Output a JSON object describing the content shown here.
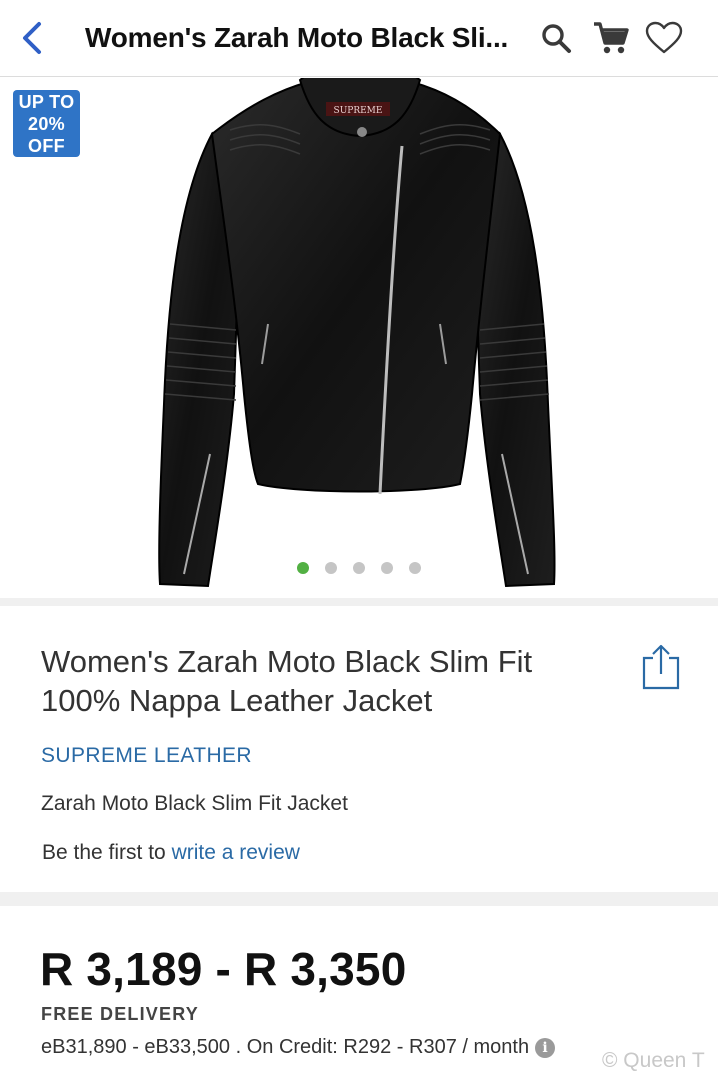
{
  "header": {
    "title": "Women's Zarah Moto Black Sli...",
    "icons": [
      "back-icon",
      "search-icon",
      "cart-icon",
      "heart-icon"
    ]
  },
  "gallery": {
    "badge_line1": "UP TO",
    "badge_line2": "20%",
    "badge_line3": "OFF",
    "label_on_jacket": "SUPREME",
    "image_count": 5,
    "active_index": 0
  },
  "product": {
    "title": "Women's Zarah Moto Black Slim Fit 100% Nappa Leather Jacket",
    "brand": "SUPREME LEATHER",
    "subtitle": "Zarah Moto Black Slim Fit Jacket",
    "review_prefix": "Be the first to ",
    "review_link": "write a review"
  },
  "pricing": {
    "price_range": "R 3,189 - R 3,350",
    "delivery": "FREE DELIVERY",
    "credit_info": "eB31,890 - eB33,500 . On Credit: R292 - R307 / month"
  },
  "watermark": "© Queen T",
  "colors": {
    "accent_blue": "#2a6aa5",
    "badge_blue": "#2f74c6",
    "active_dot": "#52b043",
    "back_arrow": "#2f5fc6"
  }
}
